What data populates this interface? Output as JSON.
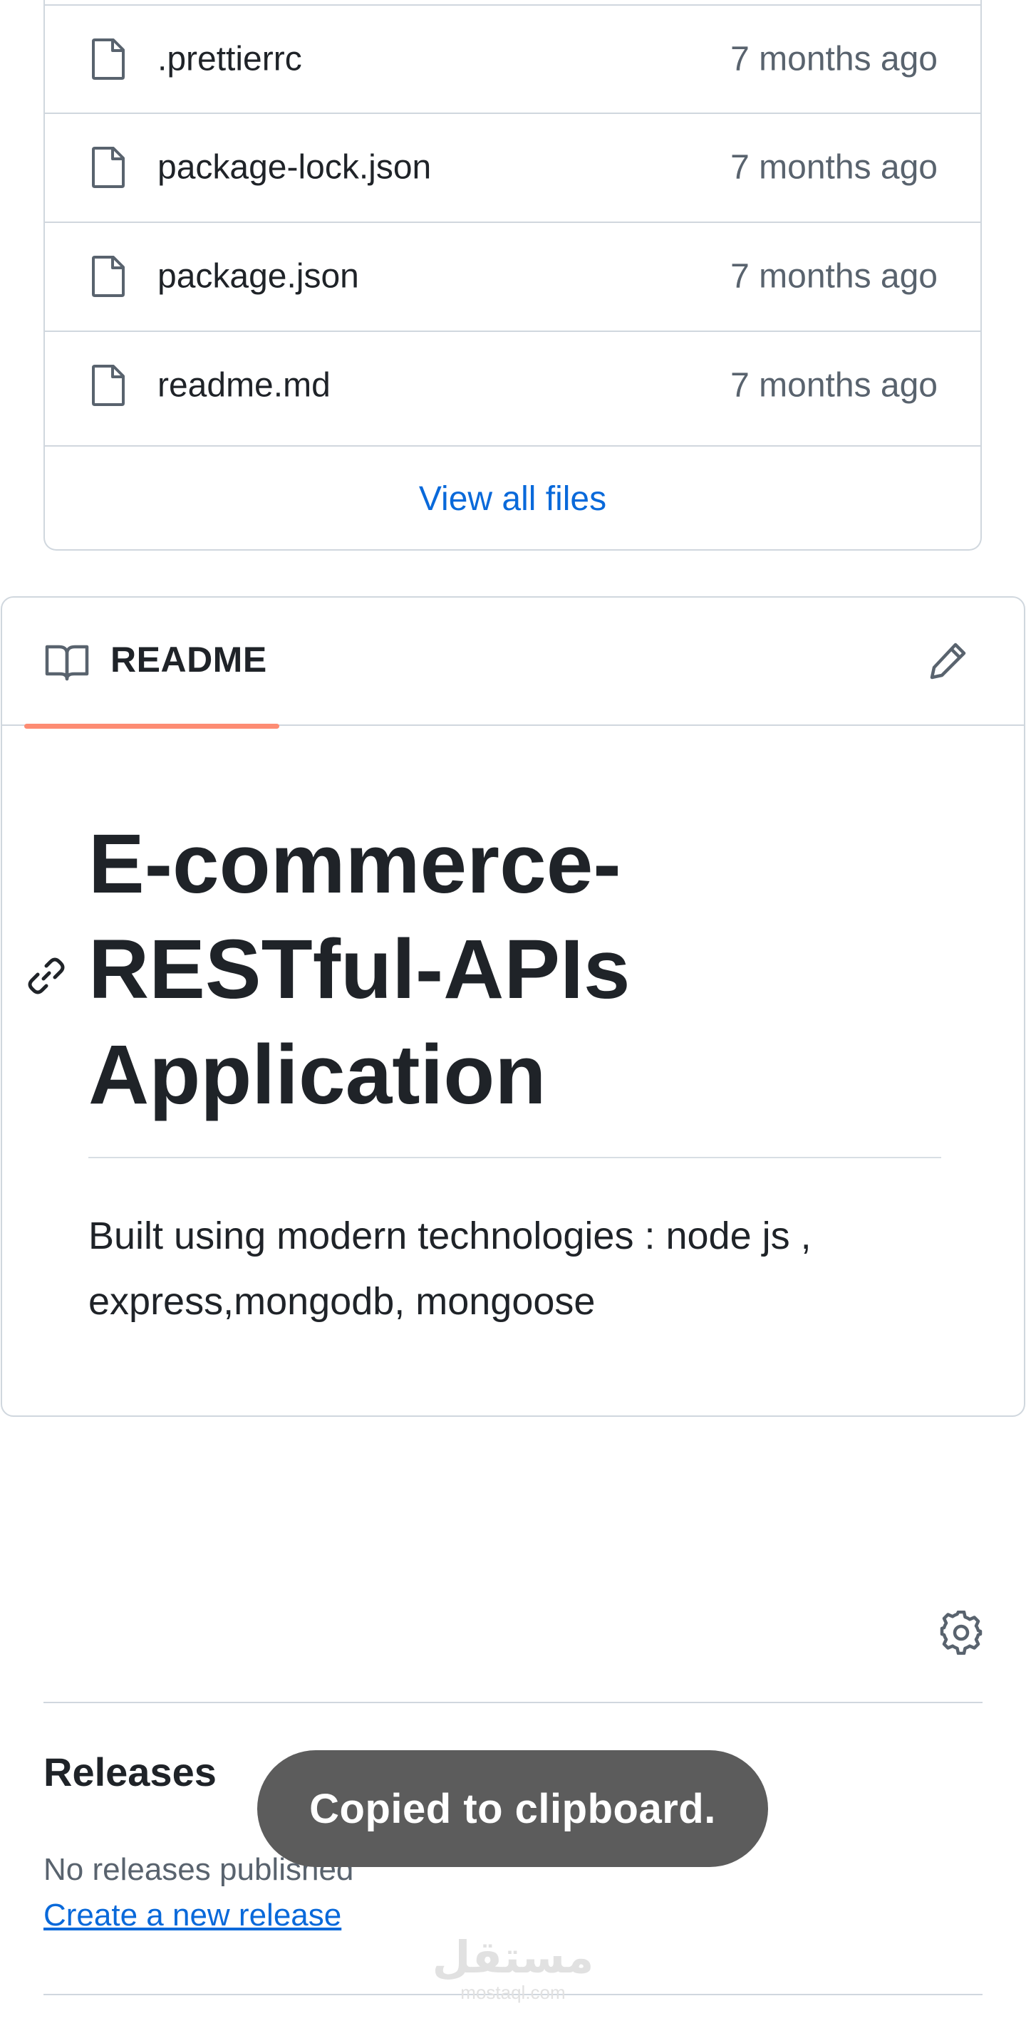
{
  "files": {
    "items": [
      {
        "name": ".prettierrc",
        "age": "7 months ago"
      },
      {
        "name": "package-lock.json",
        "age": "7 months ago"
      },
      {
        "name": "package.json",
        "age": "7 months ago"
      },
      {
        "name": "readme.md",
        "age": "7 months ago"
      }
    ],
    "view_all_label": "View all files"
  },
  "readme": {
    "tab_label": "README",
    "title": "E-commerce-RESTful-APIs Application",
    "title_lines": [
      "E-commerce-",
      "RESTful-APIs",
      "Application"
    ],
    "description": "Built using modern technologies : node js , express,mongodb, mongoose",
    "tab_accent_color": "#fd8c73"
  },
  "releases": {
    "heading": "Releases",
    "empty_text": "No releases published",
    "create_link": "Create a new release"
  },
  "toast": {
    "message": "Copied to clipboard."
  },
  "watermark": {
    "main": "مستقل",
    "sub": "mostaql.com"
  },
  "icons": {
    "file": "file-icon",
    "book": "book-icon",
    "edit": "pencil-icon",
    "anchor": "link-icon",
    "settings": "gear-icon"
  },
  "colors": {
    "link": "#0969da",
    "border": "#d0d7de",
    "muted_text": "#59636e",
    "toast_bg": "#5c5c5c"
  }
}
